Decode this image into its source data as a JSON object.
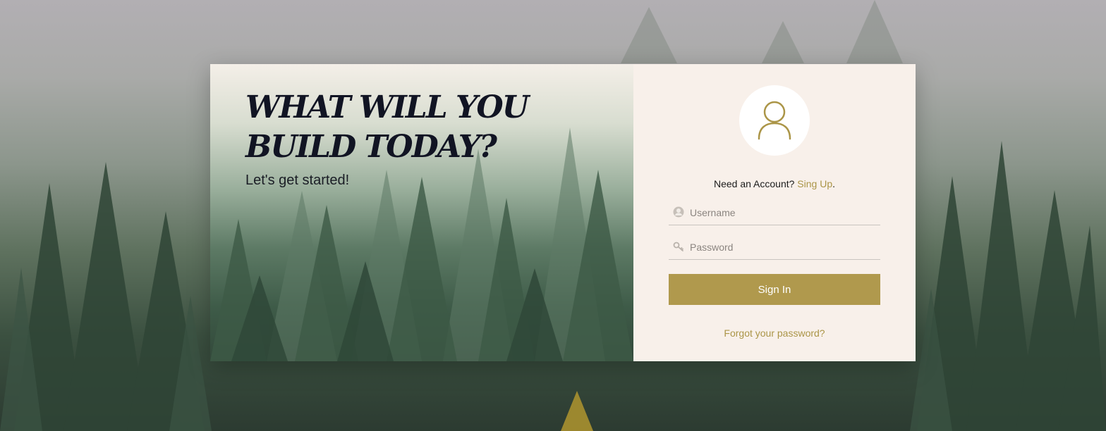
{
  "hero": {
    "title": "WHAT WILL YOU BUILD TODAY?",
    "subtitle": "Let's get started!"
  },
  "login": {
    "need_account_text": "Need an Account?",
    "signup_link": "Sing Up",
    "period": ".",
    "username_placeholder": "Username",
    "password_placeholder": "Password",
    "signin_label": "Sign In",
    "forgot_link": "Forgot your password?"
  },
  "icons": {
    "avatar": "user-outline-icon",
    "username": "user-circle-icon",
    "password": "key-icon"
  },
  "colors": {
    "accent": "#b0994d",
    "link": "#ab9547",
    "panel_bg": "#f8f0ea",
    "title": "#111423"
  }
}
